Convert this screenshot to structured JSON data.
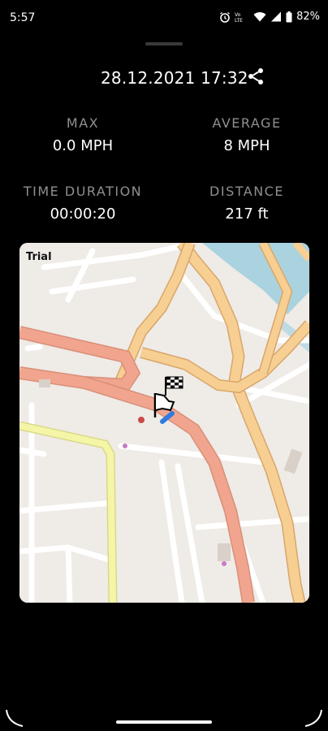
{
  "status_bar": {
    "time": "5:57",
    "battery": "82%"
  },
  "header": {
    "datetime": "28.12.2021 17:32"
  },
  "stats": [
    {
      "label": "MAX",
      "value": "0.0 MPH"
    },
    {
      "label": "AVERAGE",
      "value": "8 MPH"
    },
    {
      "label": "TIME DURATION",
      "value": "00:00:20"
    },
    {
      "label": "DISTANCE",
      "value": "217 ft"
    }
  ],
  "map": {
    "label": "Trial"
  },
  "icons": [
    "alarm-icon",
    "wifi-icon",
    "signal-icon",
    "battery-icon",
    "share-icon",
    "start-flag-icon",
    "finish-flag-icon"
  ],
  "colors": {
    "background": "#000000",
    "label": "#8f8f8f",
    "route": "#2f7be0",
    "water": "#aad3df",
    "major_road": "#f2a58e",
    "secondary_road": "#f7cf93",
    "tertiary_road": "#f5f5a8"
  }
}
